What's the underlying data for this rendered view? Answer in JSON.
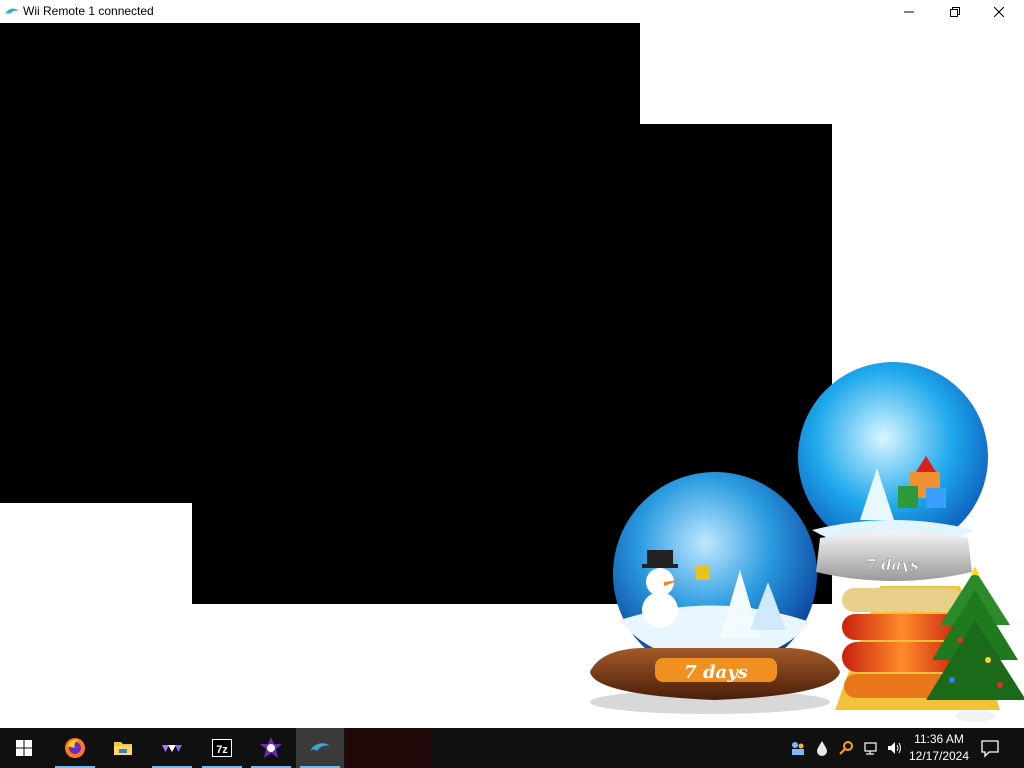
{
  "window": {
    "title": "Wii Remote 1 connected",
    "app_icon": "dolphin-icon",
    "controls": [
      "minimize-icon",
      "restore-icon",
      "close-icon"
    ]
  },
  "wallpaper": {
    "globe_left_label": "7 days",
    "globe_right_label": "7 days"
  },
  "taskbar": {
    "pinned": [
      {
        "name": "start-button",
        "icon": "windows-logo-icon"
      },
      {
        "name": "firefox-button",
        "icon": "firefox-icon"
      },
      {
        "name": "file-explorer-button",
        "icon": "folder-icon"
      },
      {
        "name": "app-button",
        "icon": "triangles-icon"
      },
      {
        "name": "7zip-button",
        "icon": "7z-icon",
        "label": "7z"
      },
      {
        "name": "app-button-2",
        "icon": "dark-star-icon"
      },
      {
        "name": "dolphin-button",
        "icon": "dolphin-icon"
      }
    ],
    "tray": [
      "people-icon",
      "droplet-icon",
      "search-key-icon",
      "network-icon",
      "speaker-icon"
    ],
    "time": "11:36 AM",
    "date": "12/17/2024",
    "notification_icon": "action-center-icon"
  }
}
